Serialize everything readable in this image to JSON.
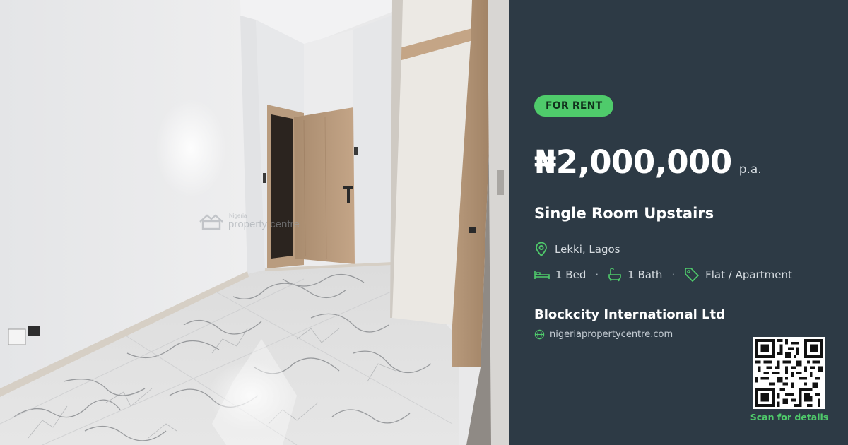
{
  "listing": {
    "badge": "FOR RENT",
    "price": "₦2,000,000",
    "period": "p.a.",
    "title": "Single Room Upstairs",
    "location": "Lekki, Lagos",
    "features": [
      {
        "icon": "bed-icon",
        "label": "1 Bed"
      },
      {
        "icon": "bath-icon",
        "label": "1 Bath"
      },
      {
        "icon": "tag-icon",
        "label": "Flat / Apartment"
      }
    ],
    "separator": "·",
    "agent": "Blockcity International Ltd",
    "website": "nigeriapropertycentre.com",
    "qr_caption": "Scan for details"
  },
  "watermark": {
    "small": "Nigeria",
    "big": "property centre"
  },
  "colors": {
    "panel_bg": "#2d3a45",
    "accent": "#4fcb6b",
    "text_primary": "#ffffff",
    "text_secondary": "#d5dbe0"
  }
}
